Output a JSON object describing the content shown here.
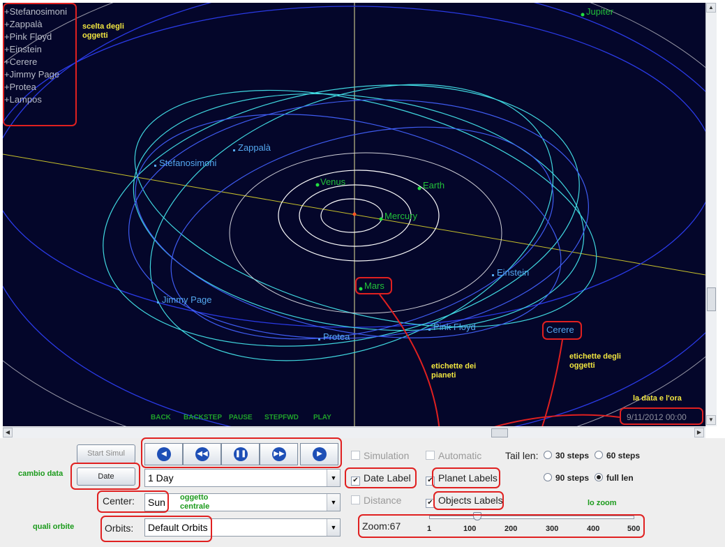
{
  "object_list": [
    "+Stefanosimoni",
    "+Zappalà",
    "+Pink Floyd",
    "+Einstein",
    "+Cerere",
    "+Jimmy Page",
    "+Protea",
    "+Lampos"
  ],
  "planets": {
    "mercury": "Mercury",
    "venus": "Venus",
    "earth": "Earth",
    "mars": "Mars",
    "jupiter": "Jupiter"
  },
  "objects": {
    "stefanosimoni": "Stefanosimoni",
    "zappala": "Zappalà",
    "einstein": "Einstein",
    "jimmy_page": "Jimmy Page",
    "protea": "Protea",
    "pink_floyd": "Pink Floyd",
    "cerere": "Cerere"
  },
  "hud": {
    "back": "BACK",
    "backstep": "BACKSTEP",
    "pause": "PAUSE",
    "stepfwd": "STEPFWD",
    "play": "PLAY"
  },
  "datetime": "9/11/2012 00:00",
  "annotations": {
    "scelta_degli_oggetti": "scelta degli oggetti",
    "etichette_dei_pianeti": "etichette dei pianeti",
    "etichette_degli_oggetti": "etichette degli oggetti",
    "la_data_e_lora": "la data e l'ora",
    "cambio_data": "cambio data",
    "oggetto_centrale": "oggetto centrale",
    "quali_orbite": "quali orbite",
    "lo_zoom": "lo zoom"
  },
  "controls": {
    "start_simul": "Start Simul",
    "date_button": "Date",
    "step_value": "1 Day",
    "center_label": "Center:",
    "center_value": "Sun",
    "orbits_label": "Orbits:",
    "orbits_value": "Default Orbits",
    "simulation": "Simulation",
    "automatic": "Automatic",
    "date_label": "Date Label",
    "planet_labels": "Planet Labels",
    "distance": "Distance",
    "objects_labels": "Objects Labels",
    "tail_len": "Tail len:",
    "tail_options": [
      "30 steps",
      "60 steps",
      "90 steps",
      "full len"
    ],
    "tail_selected": "full len",
    "zoom_label": "Zoom:67",
    "zoom_value": 67,
    "zoom_ticks": [
      "1",
      "100",
      "200",
      "300",
      "400",
      "500"
    ]
  },
  "colors": {
    "space": "#04062a",
    "planet_orbit": "#ffffff",
    "object_orbit_cyan": "#40d8e0",
    "object_orbit_blue": "#2a3ae6",
    "planet_label": "#22c03a",
    "object_label": "#54a8f0",
    "annotation_box": "#e02020"
  }
}
